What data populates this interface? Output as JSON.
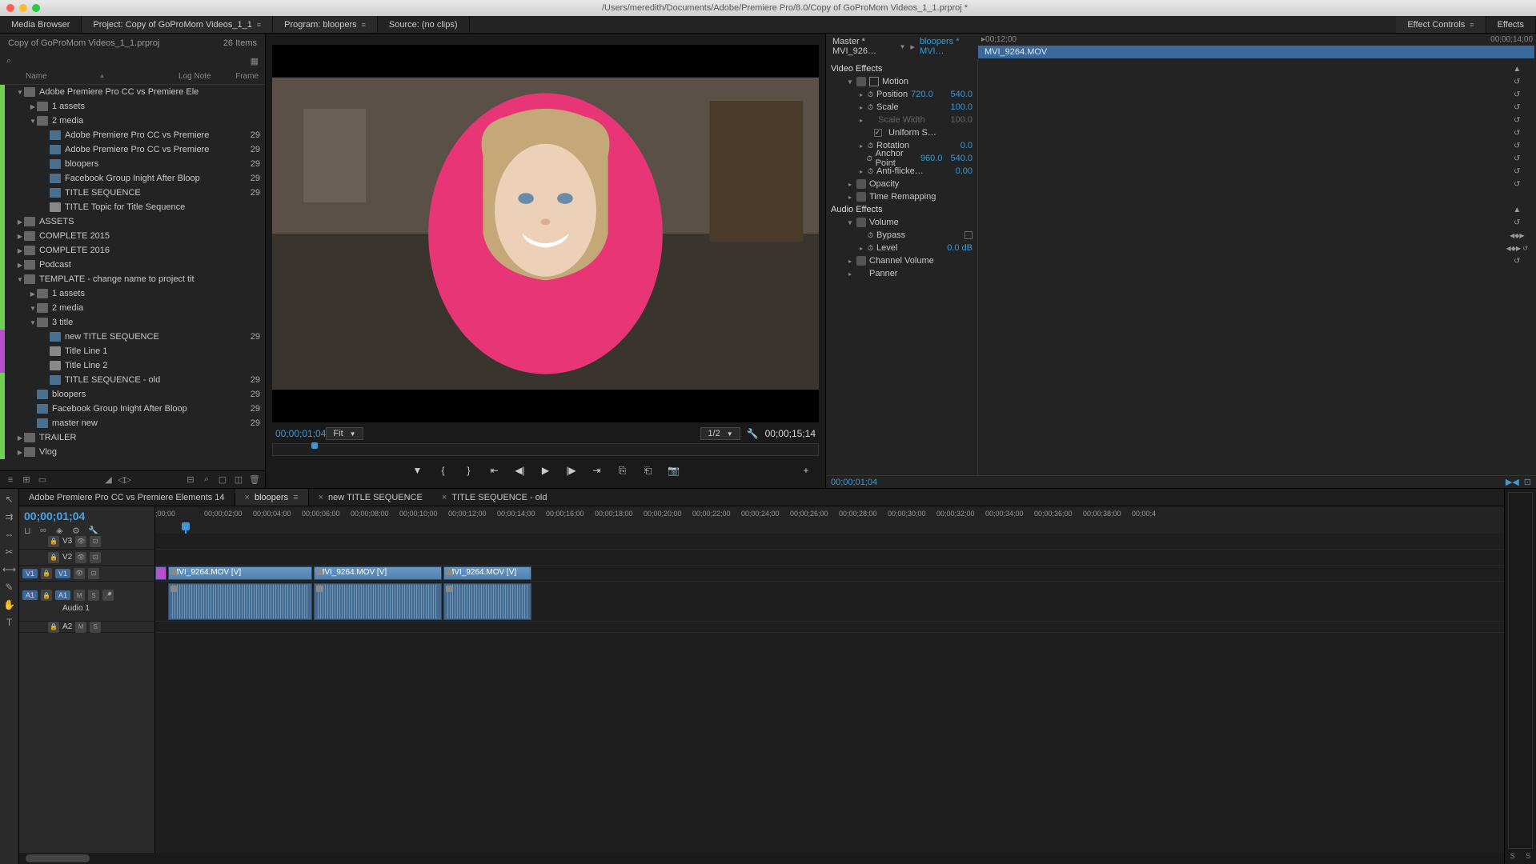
{
  "titlebar": {
    "path": "/Users/meredith/Documents/Adobe/Premiere Pro/8.0/Copy of GoProMom Videos_1_1.prproj *"
  },
  "tabs": {
    "media_browser": "Media Browser",
    "project": "Project: Copy of GoProMom Videos_1_1",
    "program": "Program: bloopers",
    "source": "Source: (no clips)",
    "effect_controls": "Effect Controls",
    "effects": "Effects"
  },
  "project": {
    "name": "Copy of GoProMom Videos_1_1.prproj",
    "item_count": "26 Items",
    "cols": {
      "name": "Name",
      "log": "Log Note",
      "frame": "Frame"
    },
    "tree": [
      {
        "indent": 0,
        "type": "folder",
        "color": "#6fcf4f",
        "open": true,
        "label": "Adobe Premiere Pro CC vs Premiere Ele"
      },
      {
        "indent": 1,
        "type": "folder",
        "color": "#6fcf4f",
        "label": "1 assets"
      },
      {
        "indent": 1,
        "type": "folder",
        "color": "#6fcf4f",
        "open": true,
        "label": "2 media"
      },
      {
        "indent": 2,
        "type": "seq",
        "color": "#6fcf4f",
        "label": "Adobe Premiere Pro CC vs Premiere",
        "num": "29"
      },
      {
        "indent": 2,
        "type": "seq",
        "color": "#6fcf4f",
        "label": "Adobe Premiere Pro CC vs Premiere",
        "num": "29"
      },
      {
        "indent": 2,
        "type": "seq",
        "color": "#6fcf4f",
        "label": "bloopers",
        "num": "29"
      },
      {
        "indent": 2,
        "type": "seq",
        "color": "#6fcf4f",
        "label": "Facebook Group Inight After Bloop",
        "num": "29"
      },
      {
        "indent": 2,
        "type": "seq",
        "color": "#6fcf4f",
        "label": "TITLE SEQUENCE",
        "num": "29"
      },
      {
        "indent": 2,
        "type": "text",
        "color": "#6fcf4f",
        "label": "TITLE Topic for Title Sequence"
      },
      {
        "indent": 0,
        "type": "folder",
        "color": "#6fcf4f",
        "label": "ASSETS"
      },
      {
        "indent": 0,
        "type": "folder",
        "color": "#6fcf4f",
        "label": "COMPLETE 2015"
      },
      {
        "indent": 0,
        "type": "folder",
        "color": "#6fcf4f",
        "label": "COMPLETE 2016"
      },
      {
        "indent": 0,
        "type": "folder",
        "color": "#6fcf4f",
        "label": "Podcast"
      },
      {
        "indent": 0,
        "type": "folder",
        "color": "#6fcf4f",
        "open": true,
        "label": "TEMPLATE - change name to project tit"
      },
      {
        "indent": 1,
        "type": "folder",
        "color": "#6fcf4f",
        "label": "1 assets"
      },
      {
        "indent": 1,
        "type": "folder",
        "color": "#6fcf4f",
        "open": true,
        "label": "2 media"
      },
      {
        "indent": 1,
        "type": "folder",
        "color": "#6fcf4f",
        "open": true,
        "label": "3 title"
      },
      {
        "indent": 2,
        "type": "seq",
        "color": "#b84fcf",
        "label": "new TITLE SEQUENCE",
        "num": "29"
      },
      {
        "indent": 2,
        "type": "text",
        "color": "#b84fcf",
        "label": "Title Line 1"
      },
      {
        "indent": 2,
        "type": "text",
        "color": "#b84fcf",
        "label": "Title Line 2"
      },
      {
        "indent": 2,
        "type": "seq",
        "color": "#6fcf4f",
        "label": "TITLE SEQUENCE - old",
        "num": "29"
      },
      {
        "indent": 1,
        "type": "seq",
        "color": "#6fcf4f",
        "label": "bloopers",
        "num": "29"
      },
      {
        "indent": 1,
        "type": "seq",
        "color": "#6fcf4f",
        "label": "Facebook Group Inight After Bloop",
        "num": "29"
      },
      {
        "indent": 1,
        "type": "seq",
        "color": "#6fcf4f",
        "label": "master new",
        "num": "29"
      },
      {
        "indent": 0,
        "type": "folder",
        "color": "#6fcf4f",
        "label": "TRAILER"
      },
      {
        "indent": 0,
        "type": "folder",
        "color": "#6fcf4f",
        "label": "Vlog"
      }
    ]
  },
  "monitor": {
    "tc_left": "00;00;01;04",
    "fit": "Fit",
    "half": "1/2",
    "tc_right": "00;00;15;14"
  },
  "effects": {
    "master": "Master * MVI_926…",
    "seq": "bloopers * MVI…",
    "tc1": "00;12;00",
    "tc2": "00;00;14;00",
    "clip": "MVI_9264.MOV",
    "sections": {
      "video": "Video Effects",
      "motion": "Motion",
      "position": {
        "label": "Position",
        "v1": "720.0",
        "v2": "540.0"
      },
      "scale": {
        "label": "Scale",
        "v": "100.0"
      },
      "scale_width": {
        "label": "Scale Width",
        "v": "100.0"
      },
      "uniform": "Uniform S…",
      "rotation": {
        "label": "Rotation",
        "v": "0.0"
      },
      "anchor": {
        "label": "Anchor Point",
        "v1": "960.0",
        "v2": "540.0"
      },
      "flicker": {
        "label": "Anti-flicke…",
        "v": "0.00"
      },
      "opacity": "Opacity",
      "time": "Time Remapping",
      "audio": "Audio Effects",
      "volume": "Volume",
      "bypass": "Bypass",
      "level": {
        "label": "Level",
        "v": "0.0 dB"
      },
      "channel": "Channel Volume",
      "panner": "Panner"
    },
    "footer_tc": "00;00;01;04"
  },
  "timeline": {
    "tabs": [
      {
        "label": "Adobe Premiere Pro CC vs Premiere Elements 14"
      },
      {
        "label": "bloopers",
        "active": true
      },
      {
        "label": "new TITLE SEQUENCE",
        "close": true
      },
      {
        "label": "TITLE SEQUENCE - old",
        "close": true
      }
    ],
    "tc": "00;00;01;04",
    "ruler": [
      ";00;00",
      "00;00;02;00",
      "00;00;04;00",
      "00;00;06;00",
      "00;00;08;00",
      "00;00;10;00",
      "00;00;12;00",
      "00;00;14;00",
      "00;00;16;00",
      "00;00;18;00",
      "00;00;20;00",
      "00;00;22;00",
      "00;00;24;00",
      "00;00;26;00",
      "00;00;28;00",
      "00;00;30;00",
      "00;00;32;00",
      "00;00;34;00",
      "00;00;36;00",
      "00;00;38;00",
      "00;00;4"
    ],
    "tracks": {
      "v3": "V3",
      "v2": "V2",
      "v1": "V1",
      "v1patch": "V1",
      "a1": "A1",
      "a1patch": "A1",
      "a1name": "Audio 1",
      "a2": "A2"
    },
    "clips": {
      "c1": "MVI_9264.MOV [V]",
      "c2": "MVI_9264.MOV [V]",
      "c3": "MVI_9264.MOV [V]"
    },
    "meter": {
      "s1": "S",
      "s2": "S"
    }
  }
}
